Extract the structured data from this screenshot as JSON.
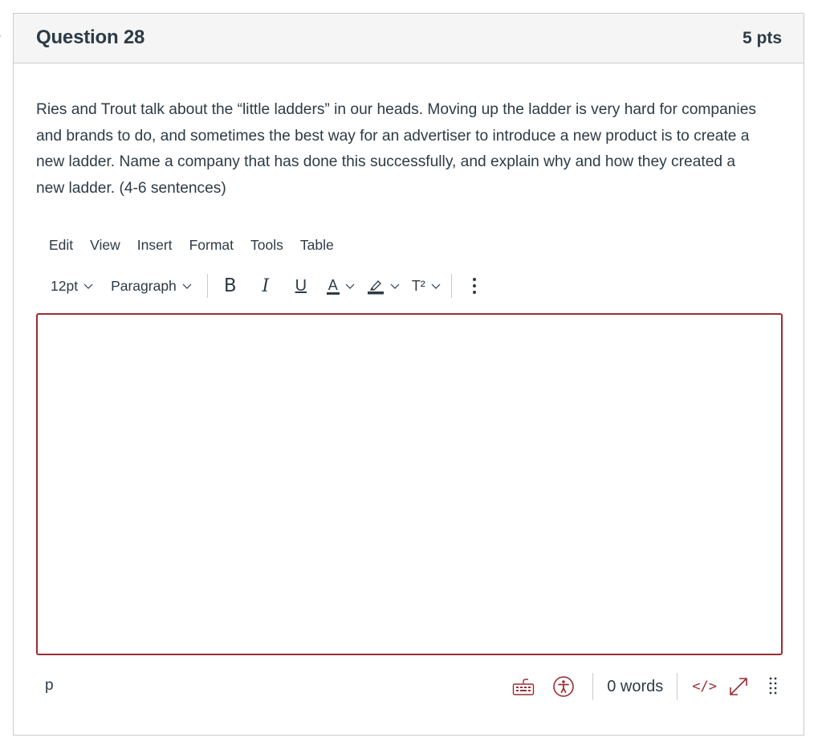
{
  "question": {
    "title": "Question 28",
    "points": "5 pts",
    "text": "Ries and Trout talk about the “little ladders” in our heads. Moving up the ladder is very hard for companies and brands to do, and sometimes the best way for an advertiser to introduce a new product is to create a new ladder. Name a company that has done this successfully, and explain why and how they created a new ladder. (4-6 sentences)"
  },
  "editor": {
    "menubar": [
      "Edit",
      "View",
      "Insert",
      "Format",
      "Tools",
      "Table"
    ],
    "toolbar": {
      "font_size": "12pt",
      "block_format": "Paragraph",
      "bold_label": "B",
      "italic_label": "I",
      "underline_label": "U",
      "text_color_label": "A",
      "superscript_label": "T²"
    },
    "content": "",
    "status": {
      "path": "p",
      "word_count": "0 words",
      "html_toggle_label": "</>"
    },
    "accent_color": "#9b2d35"
  },
  "icons": {
    "more": "vertical-ellipsis-icon",
    "keyboard": "keyboard-icon",
    "accessibility": "accessibility-icon",
    "fullscreen": "expand-arrow-icon",
    "resize": "resize-grip-icon"
  }
}
